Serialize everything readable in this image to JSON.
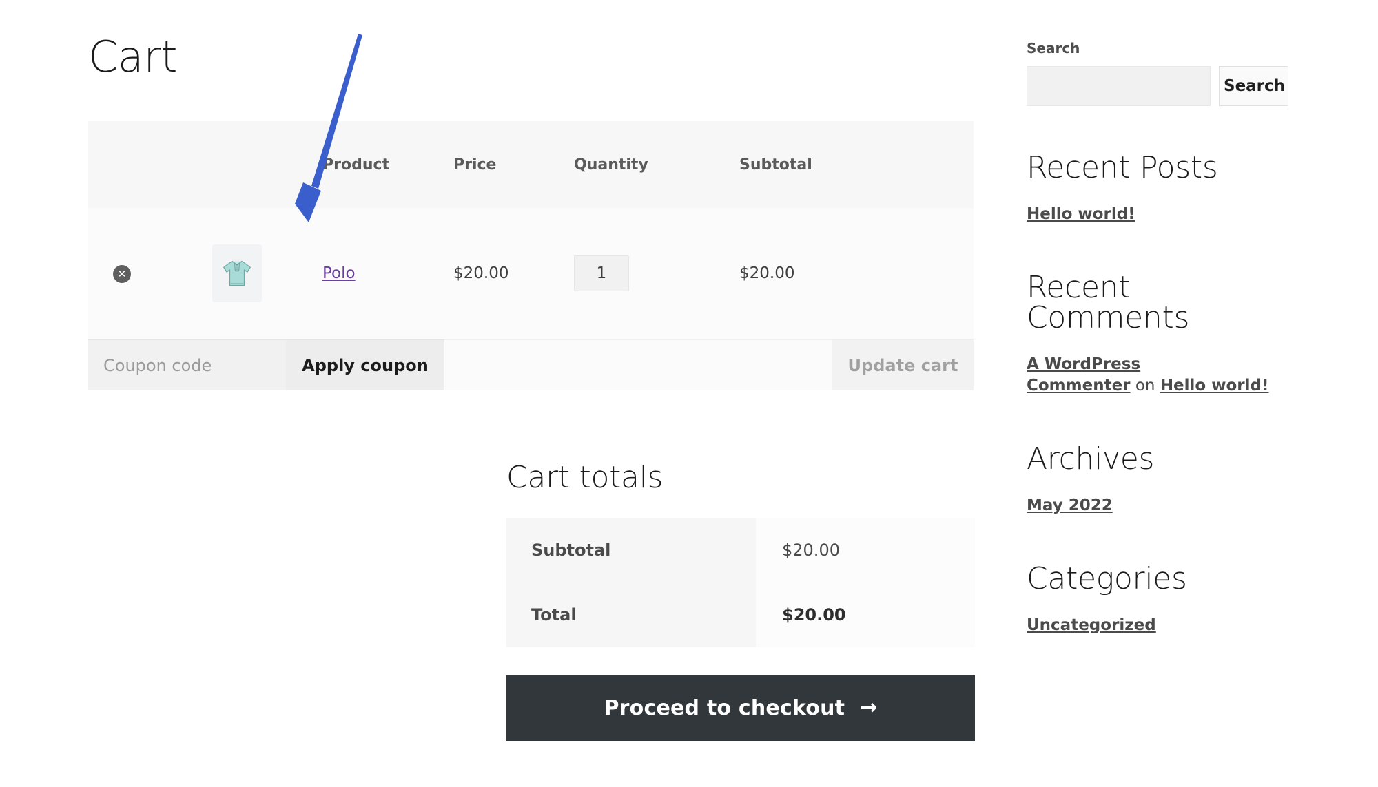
{
  "cart": {
    "title": "Cart",
    "table": {
      "headers": [
        "",
        "",
        "Product",
        "Price",
        "Quantity",
        "Subtotal"
      ],
      "header_product": "Product",
      "header_price": "Price",
      "header_quantity": "Quantity",
      "header_subtotal": "Subtotal",
      "rows": [
        {
          "remove_icon": "remove-x-icon",
          "thumbnail": "polo-shirt-thumbnail",
          "product": "Polo",
          "price": "$20.00",
          "quantity": "1",
          "subtotal": "$20.00"
        }
      ]
    },
    "coupon": {
      "placeholder": "Coupon code",
      "value": "",
      "apply_label": "Apply coupon"
    },
    "update_cart_label": "Update cart"
  },
  "totals": {
    "title": "Cart totals",
    "rows": [
      {
        "label": "Subtotal",
        "value": "$20.00"
      },
      {
        "label": "Total",
        "value": "$20.00"
      }
    ],
    "subtotal_label": "Subtotal",
    "subtotal_value": "$20.00",
    "total_label": "Total",
    "total_value": "$20.00",
    "checkout_label": "Proceed to checkout",
    "checkout_arrow": "→"
  },
  "sidebar": {
    "search": {
      "label": "Search",
      "value": "",
      "placeholder": "",
      "button_label": "Search"
    },
    "recent_posts": {
      "title": "Recent Posts",
      "items": [
        {
          "label": "Hello world!"
        }
      ],
      "item_0": "Hello world!"
    },
    "recent_comments": {
      "title": "Recent Comments",
      "author": "A WordPress Commenter",
      "on": "on",
      "post": "Hello world!"
    },
    "archives": {
      "title": "Archives",
      "item_0": "May 2022"
    },
    "categories": {
      "title": "Categories",
      "item_0": "Uncategorized"
    }
  },
  "annotation": {
    "name": "blue-arrow-annotation",
    "color": "#3a5fcd",
    "points_to": "product-thumbnail"
  },
  "colors": {
    "link_purple": "#6b3fa0",
    "checkout_dark": "#32373c",
    "table_header_bg": "#f7f7f7",
    "row_bg": "#fbfbfb",
    "arrow_blue": "#3a5fcd",
    "shirt_teal": "#a9dcd8"
  }
}
